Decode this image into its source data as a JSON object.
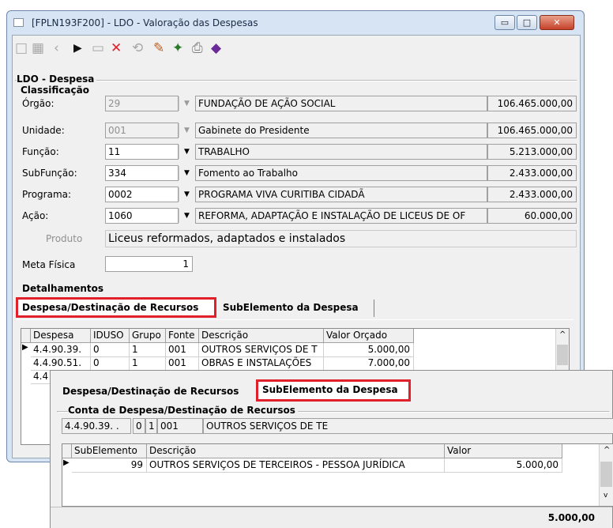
{
  "window": {
    "title": "[FPLN193F200] - LDO - Valoração das Despesas",
    "min": "▭",
    "max": "□",
    "close": "✕"
  },
  "toolbar": {
    "icons": [
      "new-icon",
      "grid-icon",
      "back-icon",
      "play-icon",
      "doc-icon",
      "delete-icon",
      "undo-icon",
      "pencil-icon",
      "exit-icon",
      "print-icon",
      "book-icon"
    ],
    "glyphs": [
      "□",
      "▦",
      "‹",
      "▶",
      "▭",
      "✕",
      "⟲",
      "✎",
      "✦",
      "⎙",
      "◆"
    ]
  },
  "section": {
    "title": "LDO - Despesa",
    "classification": "Classificação"
  },
  "fields": [
    {
      "label": "Órgão:",
      "code": "29",
      "desc": "FUNDAÇÃO DE AÇÃO SOCIAL",
      "value": "106.465.000,00",
      "enabled": false
    },
    {
      "label": "Unidade:",
      "code": "001",
      "desc": "Gabinete do Presidente",
      "value": "106.465.000,00",
      "enabled": false
    },
    {
      "label": "Função:",
      "code": "11",
      "desc": "TRABALHO",
      "value": "5.213.000,00",
      "enabled": true
    },
    {
      "label": "SubFunção:",
      "code": "334",
      "desc": "Fomento ao Trabalho",
      "value": "2.433.000,00",
      "enabled": true
    },
    {
      "label": "Programa:",
      "code": "0002",
      "desc": "PROGRAMA VIVA CURITIBA CIDADÃ",
      "value": "2.433.000,00",
      "enabled": true
    },
    {
      "label": "Ação:",
      "code": "1060",
      "desc": "REFORMA, ADAPTAÇÃO E INSTALAÇÃO DE LICEUS DE OF",
      "value": "60.000,00",
      "enabled": true
    }
  ],
  "produto": {
    "label": "Produto",
    "value": "Liceus reformados, adaptados e instalados"
  },
  "meta": {
    "label": "Meta Física",
    "value": "1"
  },
  "detalhamentos": "Detalhamentos",
  "tabs": {
    "despesa": "Despesa/Destinação de Recursos",
    "subelemento": "SubElemento da Despesa"
  },
  "grid1": {
    "headers": [
      "Despesa",
      "IDUSO",
      "Grupo",
      "Fonte",
      "Descrição",
      "Valor Orçado"
    ],
    "rows": [
      [
        "4.4.90.39.",
        "0",
        "1",
        "001",
        "OUTROS SERVIÇOS DE T",
        "5.000,00"
      ],
      [
        "4.4.90.51.",
        "0",
        "1",
        "001",
        "OBRAS E INSTALAÇÕES",
        "7.000,00"
      ],
      [
        "4.4",
        "",
        "",
        "",
        "",
        ""
      ]
    ]
  },
  "popup": {
    "tab_left": "Despesa/Destinação de Recursos",
    "tab_right": "SubElemento da Despesa",
    "group": "Conta de Despesa/Destinação de Recursos",
    "conta": {
      "despesa": "4.4.90.39. .",
      "a": "0",
      "b": "1",
      "fonte": "001",
      "desc": "OUTROS SERVIÇOS DE TE"
    },
    "headers": [
      "SubElemento",
      "Descrição",
      "Valor"
    ],
    "row": {
      "sub": "99",
      "desc": "OUTROS SERVIÇOS DE TERCEIROS - PESSOA JURÍDICA",
      "valor": "5.000,00"
    },
    "total": "5.000,00"
  },
  "colors": {
    "highlight": "#e0202a",
    "titlebar": "#d6e4f3"
  }
}
